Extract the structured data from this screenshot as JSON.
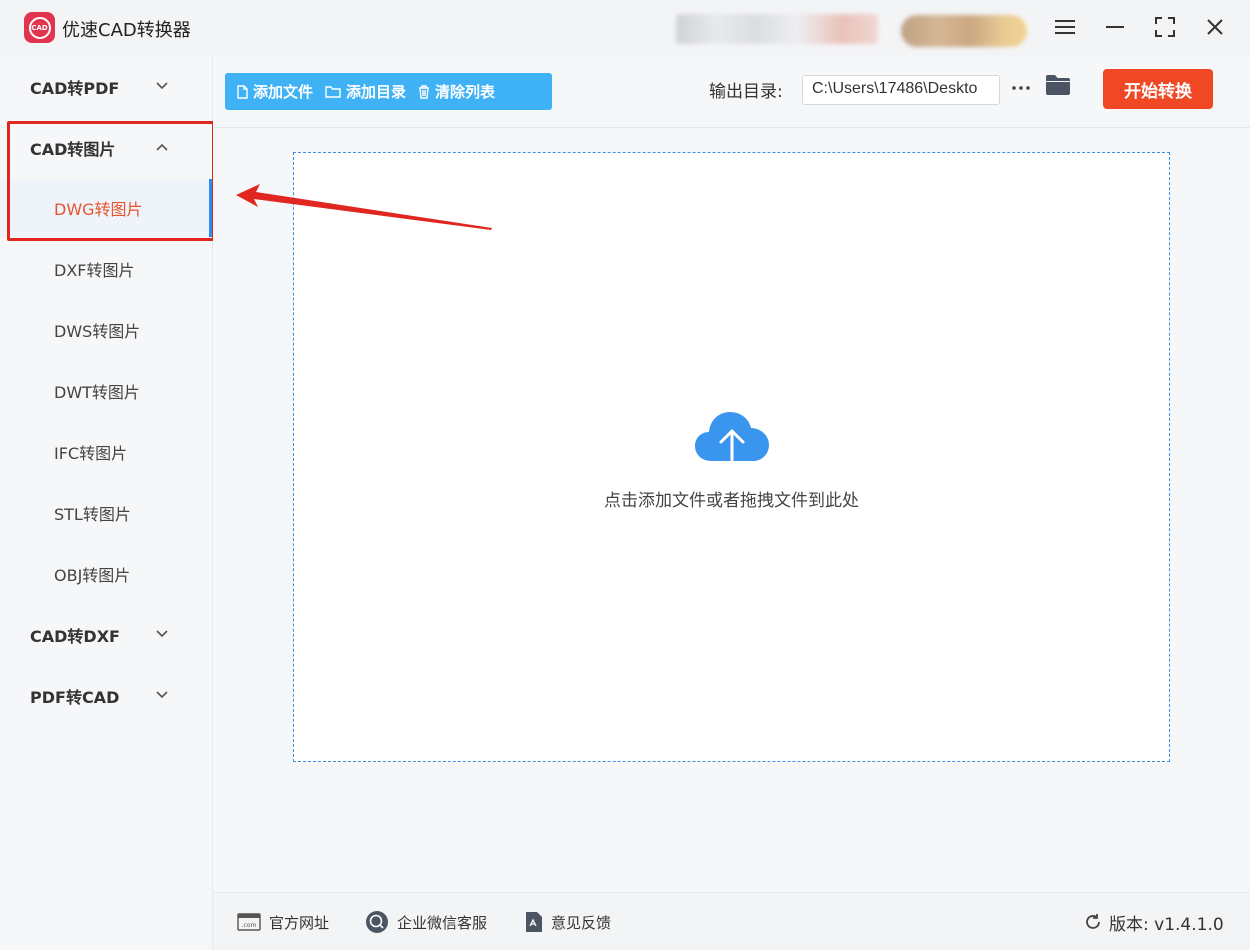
{
  "window": {
    "title": "优速CAD转换器",
    "logo_text": "CAD"
  },
  "sidebar": {
    "groups": [
      {
        "label": "CAD转PDF",
        "expanded": false
      },
      {
        "label": "CAD转图片",
        "expanded": true,
        "items": [
          "DWG转图片",
          "DXF转图片",
          "DWS转图片",
          "DWT转图片",
          "IFC转图片",
          "STL转图片",
          "OBJ转图片"
        ],
        "active_item": "DWG转图片"
      },
      {
        "label": "CAD转DXF",
        "expanded": false
      },
      {
        "label": "PDF转CAD",
        "expanded": false
      }
    ]
  },
  "toolbar": {
    "add_file": "添加文件",
    "add_dir": "添加目录",
    "clear_list": "清除列表",
    "output_label": "输出目录:",
    "output_path": "C:\\Users\\17486\\Deskto",
    "more": "···",
    "start": "开始转换"
  },
  "dropzone": {
    "hint": "点击添加文件或者拖拽文件到此处"
  },
  "footer": {
    "website": "官方网址",
    "wechat": "企业微信客服",
    "feedback": "意见反馈",
    "version": "版本: v1.4.1.0",
    "website_icon_text": ".com"
  },
  "colors": {
    "accent_blue": "#3fb1f5",
    "start_red": "#f04824",
    "active_text": "#e8542d",
    "annotation_red": "#e0271f"
  }
}
